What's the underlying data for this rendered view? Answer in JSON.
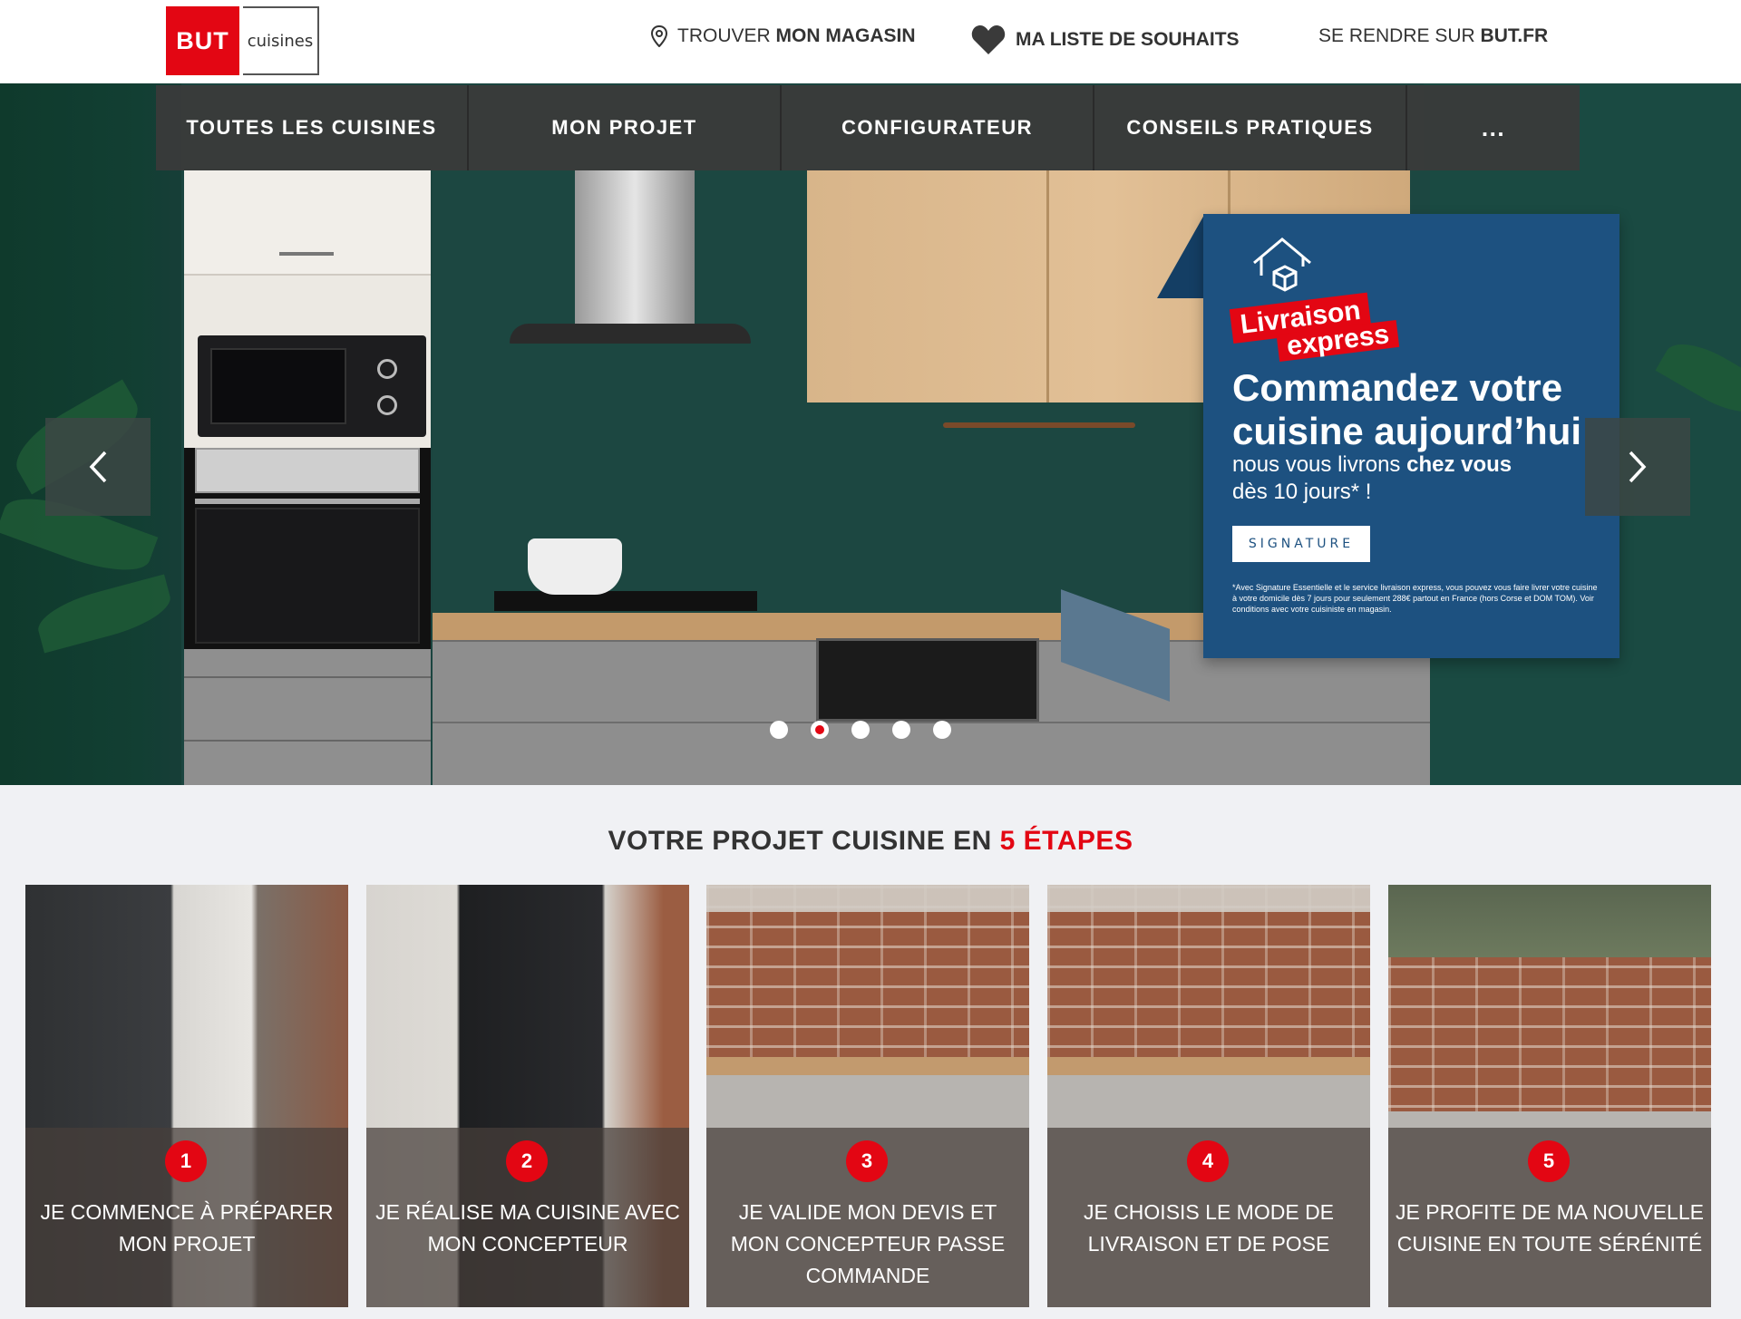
{
  "header": {
    "logo_brand": "BUT",
    "logo_sub": "cuisines",
    "store_link": {
      "prefix": "TROUVER ",
      "strong": "MON MAGASIN"
    },
    "wishlist_link": "MA LISTE DE SOUHAITS",
    "site_link": {
      "prefix": "SE RENDRE SUR ",
      "strong": "BUT.FR"
    }
  },
  "nav": {
    "items": [
      "TOUTES LES CUISINES",
      "MON PROJET",
      "CONFIGURATEUR",
      "CONSEILS PRATIQUES",
      "..."
    ]
  },
  "hero": {
    "promo": {
      "badge_line1": "Livraison",
      "badge_line2": "express",
      "headline_line1": "Commandez votre",
      "headline_line2": "cuisine aujourd’hui",
      "sub_prefix": "nous vous livrons ",
      "sub_strong": "chez vous",
      "sub_line2": "dès 10 jours* !",
      "signature_logo": "SIGNATURE",
      "fine_print": "*Avec Signature Essentielle et le service livraison express, vous pouvez vous faire livrer votre cuisine à votre domicile dès 7 jours pour seulement 288€ partout en France (hors Corse et DOM TOM). Voir conditions avec votre cuisiniste en magasin."
    },
    "carousel": {
      "total": 5,
      "active_index": 1
    }
  },
  "steps": {
    "title_prefix": "VOTRE PROJET CUISINE EN ",
    "title_highlight": "5 ÉTAPES",
    "items": [
      {
        "number": "1",
        "label": "JE COMMENCE À PRÉPARER MON PROJET"
      },
      {
        "number": "2",
        "label": "JE RÉALISE MA CUISINE AVEC MON CONCEPTEUR"
      },
      {
        "number": "3",
        "label": "JE VALIDE MON DEVIS ET MON CONCEPTEUR PASSE COMMANDE"
      },
      {
        "number": "4",
        "label": "JE CHOISIS LE MODE DE LIVRAISON ET DE POSE"
      },
      {
        "number": "5",
        "label": "JE PROFITE DE MA NOUVELLE CUISINE EN TOUTE SÉRÉNITÉ"
      }
    ]
  },
  "colors": {
    "brand_red": "#e30613",
    "promo_blue": "#1d5180",
    "nav_dark": "#3a3a3a"
  }
}
